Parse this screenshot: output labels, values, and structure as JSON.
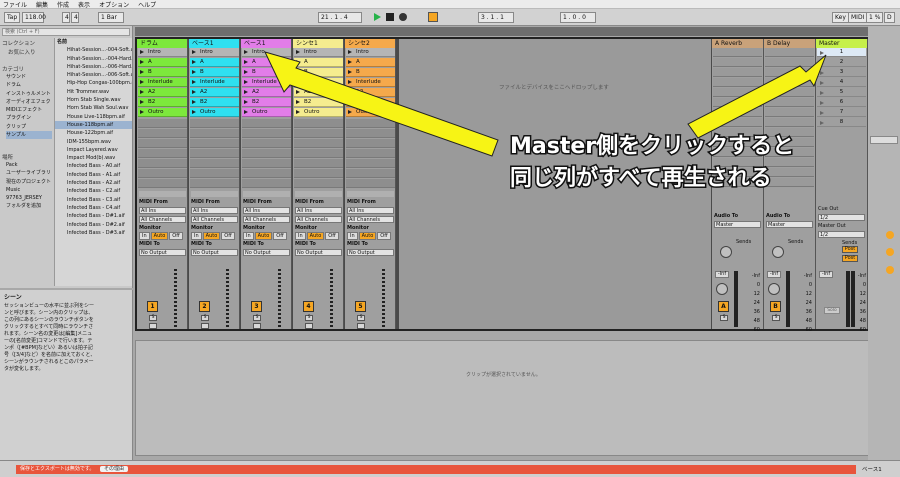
{
  "menubar": {
    "items": [
      "ファイル",
      "編集",
      "作成",
      "表示",
      "オプション",
      "ヘルプ"
    ]
  },
  "transport": {
    "tap": "Tap",
    "tempo": "118.00",
    "sig_num": "4",
    "sig_den": "4",
    "quantize": "1 Bar",
    "position": "21 . 1 . 4",
    "loop_start": "3 . 1 . 1",
    "loop_len": "1 . 0 . 0",
    "key": "Key",
    "midi": "MIDI",
    "cpu": "1 %",
    "d": "D"
  },
  "browser": {
    "search_placeholder": "検索 (Ctrl + F)",
    "sections": {
      "collection": "コレクション",
      "favorites": "お気に入り",
      "category": "カテゴリ",
      "places": "場所"
    },
    "categories": [
      "サウンド",
      "ドラム",
      "インストゥルメント",
      "オーディオエフェクト",
      "MIDIエフェクト",
      "プラグイン",
      "クリップ",
      "サンプル"
    ],
    "places": [
      "Pack",
      "ユーザーライブラリ",
      "現在のプロジェクト",
      "Music",
      "97763_JERSEY",
      "フォルダを追加"
    ],
    "name_header": "名前",
    "files": [
      "Hihat-Session...-004-Soft.aif",
      "Hihat-Session...-004-Hard.aif",
      "Hihat-Session...-006-Hard.aif",
      "Hihat-Session...-006-Soft.aif",
      "Hip-Hop Congas-100bpm.aif",
      "Hit Trommer.wav",
      "Horn Stab Single.wav",
      "Horn Stab Wah Soul.wav",
      "House Live-118bpm.aif",
      "House-118bpm.aif",
      "House-122bpm.aif",
      "IDM-155bpm.wav",
      "Impact Layered.wav",
      "Impact Mod(b).wav",
      "Infected Bass - A0.aif",
      "Infected Bass - A1.aif",
      "Infected Bass - A2.aif",
      "Infected Bass - C2.aif",
      "Infected Bass - C3.aif",
      "Infected Bass - C4.aif",
      "Infected Bass - D#1.aif",
      "Infected Bass - D#2.aif",
      "Infected Bass - D#3.aif"
    ]
  },
  "help": {
    "title": "シーン",
    "body": "セッションビューの水平に並ぶ列をシーンと呼びます。シーン内のクリップは、この列にあるシーンのラウンチボタンをクリックするとすべて同時にラウンチされます。シーン名の変更は[編集]メニューの[名前変更]コマンドで行います。テンポ（[#BPM]などい）あるいは拍子記号（[3/4]など）を名前に加えておくと、シーンがラウンチされるとこのパラメータが変化します。"
  },
  "tracks": [
    {
      "name": "ドラム",
      "color": "#7de83c",
      "number": "1",
      "clips": [
        "Intro",
        "A",
        "B",
        "Interlude",
        "A2",
        "B2",
        "Outro"
      ]
    },
    {
      "name": "ベース1",
      "color": "#2fe0f0",
      "number": "2",
      "clips": [
        "Intro",
        "A",
        "B",
        "Interlude",
        "A2",
        "B2",
        "Outro"
      ]
    },
    {
      "name": "ベース1",
      "color": "#e27de8",
      "number": "3",
      "clips": [
        "Intro",
        "A",
        "B",
        "Interlude",
        "A2",
        "B2",
        "Outro"
      ]
    },
    {
      "name": "シンセ1",
      "color": "#f5ec8f",
      "number": "4",
      "clips": [
        "Intro",
        "A",
        "B",
        "Interlude",
        "A2",
        "B2",
        "Outro"
      ]
    },
    {
      "name": "シンセ2",
      "color": "#f5a94b",
      "number": "5",
      "clips": [
        "Intro",
        "A",
        "B",
        "Interlude",
        "A2",
        "B2",
        "Outro"
      ]
    }
  ],
  "io": {
    "midi_from": "MIDI From",
    "all_ins": "All Ins",
    "all_channels": "All Channels",
    "monitor": "Monitor",
    "in": "In",
    "auto": "Auto",
    "off": "Off",
    "midi_to": "MIDI To",
    "no_output": "No Output",
    "s": "S"
  },
  "returns": [
    {
      "name": "A Reverb",
      "letter": "A",
      "color": "#f5a623"
    },
    {
      "name": "B Delay",
      "letter": "B",
      "color": "#f5a623"
    }
  ],
  "master": {
    "name": "Master",
    "scenes": [
      "1",
      "2",
      "3",
      "4",
      "5",
      "6",
      "7",
      "8"
    ],
    "cue_out": "Cue Out",
    "cue_val": "1/2",
    "master_out": "Master Out",
    "master_val": "1/2",
    "audio_to": "Audio To",
    "sends": "Sends",
    "post": "Post",
    "solo": "Solo"
  },
  "scale": [
    "-Inf",
    "0",
    "12",
    "24",
    "36",
    "48",
    "60"
  ],
  "drop_hint": "ファイルとデバイスをここへドロップします",
  "detail_hint": "クリップが選択されていません。",
  "annotation": {
    "line1": "Master側をクリックすると",
    "line2": "同じ列がすべて再生される"
  },
  "status": {
    "message": "保存とエクスポートは無効です。",
    "button": "その理由",
    "track": "ベース1"
  }
}
